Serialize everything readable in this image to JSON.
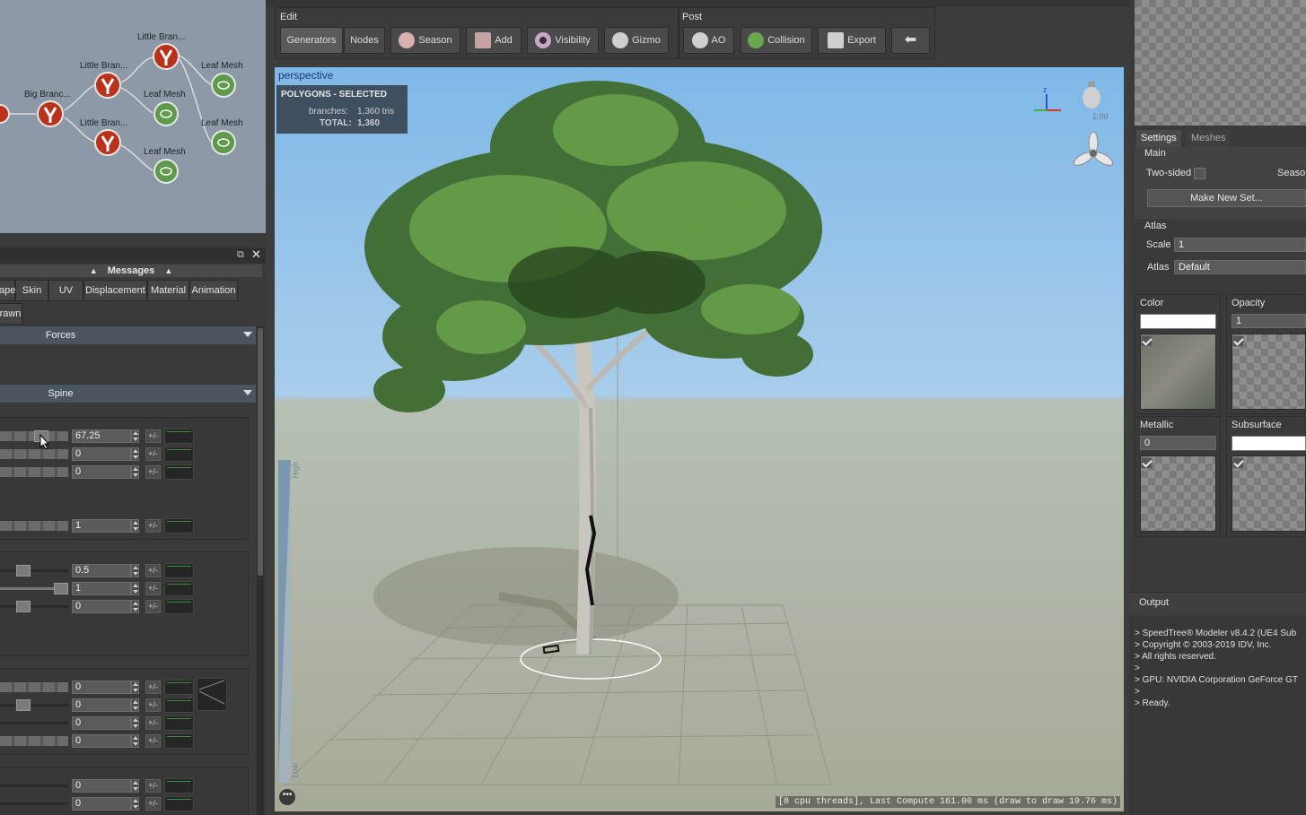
{
  "node_graph": {
    "nodes": [
      {
        "label": "Little Bran...",
        "type": "branch"
      },
      {
        "label": "Little Bran...",
        "type": "branch"
      },
      {
        "label": "Big Branc...",
        "type": "branch"
      },
      {
        "label": "Little Bran...",
        "type": "branch"
      },
      {
        "label": "Leaf Mesh",
        "type": "leaf"
      },
      {
        "label": "Leaf Mesh",
        "type": "leaf"
      },
      {
        "label": "Leaf Mesh",
        "type": "leaf"
      },
      {
        "label": "Leaf Mesh",
        "type": "leaf"
      }
    ]
  },
  "left_panel": {
    "messages_label": "Messages",
    "tabs": [
      "ape",
      "Skin",
      "UV",
      "Displacement",
      "Material",
      "Animation"
    ],
    "tab_row2": "rawn",
    "sections": [
      "Forces",
      "Spine"
    ],
    "group1_values": [
      "67.25",
      "0",
      "0"
    ],
    "group2_values": [
      "1"
    ],
    "group3_values": [
      "0.5",
      "1",
      "0"
    ],
    "group4_values": [
      "0",
      "0",
      "0",
      "0"
    ],
    "group5_values": [
      "0",
      "0"
    ],
    "plusminus": "+/-"
  },
  "toolbar": {
    "edit_label": "Edit",
    "post_label": "Post",
    "edit_buttons": [
      {
        "label": "Generators",
        "icon": "none"
      },
      {
        "label": "Nodes",
        "icon": "none"
      },
      {
        "label": "Season",
        "icon": "season-icon"
      },
      {
        "label": "Add",
        "icon": "add-icon"
      },
      {
        "label": "Visibility",
        "icon": "eye-icon"
      },
      {
        "label": "Gizmo",
        "icon": "gizmo-icon"
      }
    ],
    "post_buttons": [
      {
        "label": "AO",
        "icon": "ao-icon"
      },
      {
        "label": "Collision",
        "icon": "collision-icon"
      },
      {
        "label": "Export",
        "icon": "export-icon"
      },
      {
        "label": "",
        "icon": "back-arrow-icon"
      }
    ]
  },
  "viewport": {
    "view_name": "perspective",
    "stats_title": "POLYGONS - SELECTED",
    "branches_label": "branches:",
    "branches_value": "1,360 tris",
    "total_label": "TOTAL:",
    "total_value": "1,360",
    "light_value": "2.00",
    "gradient_high": "High",
    "gradient_low": "Low",
    "axis_z": "z",
    "status": "[8 cpu threads], Last Compute 161.00 ms (draw to draw 19.76 ms)"
  },
  "right_panel": {
    "tabs": [
      "Settings",
      "Meshes"
    ],
    "main_label": "Main",
    "two_sided_label": "Two-sided",
    "season_label": "Seaso",
    "make_new_set": "Make New Set...",
    "atlas_group": "Atlas",
    "scale_label": "Scale",
    "scale_value": "1",
    "atlas_label": "Atlas",
    "atlas_value": "Default",
    "color_label": "Color",
    "opacity_label": "Opacity",
    "opacity_value": "1",
    "metallic_label": "Metallic",
    "metallic_value": "0",
    "subsurface_label": "Subsurface",
    "output_title": "Output",
    "output_lines": "> SpeedTree® Modeler v8.4.2 (UE4 Sub\n> Copyright © 2003-2019 IDV, Inc.\n> All rights reserved.\n>\n> GPU: NVIDIA Corporation GeForce GT\n>\n> Ready."
  },
  "colors": {
    "branch_node": "#b8321c",
    "leaf_node": "#5f9a4a",
    "sky_top": "#7fb8e8",
    "ground": "#a6aa98"
  }
}
